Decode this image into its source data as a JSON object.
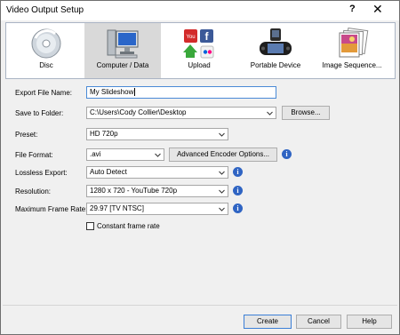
{
  "window": {
    "title": "Video Output Setup",
    "help_glyph": "?",
    "close_glyph": "✕"
  },
  "tabs": [
    {
      "label": "Disc",
      "icon": "disc-icon",
      "selected": false
    },
    {
      "label": "Computer / Data",
      "icon": "computer-icon",
      "selected": true
    },
    {
      "label": "Upload",
      "icon": "upload-icon",
      "selected": false
    },
    {
      "label": "Portable Device",
      "icon": "portable-device-icon",
      "selected": false
    },
    {
      "label": "Image Sequence...",
      "icon": "image-sequence-icon",
      "selected": false
    }
  ],
  "form": {
    "export_name": {
      "label": "Export File Name:",
      "value": "My Slideshow"
    },
    "save_folder": {
      "label": "Save to Folder:",
      "value": "C:\\Users\\Cody Collier\\Desktop",
      "browse": "Browse..."
    },
    "preset": {
      "label": "Preset:",
      "value": "HD 720p"
    },
    "file_format": {
      "label": "File Format:",
      "value": ".avi",
      "advanced": "Advanced Encoder Options..."
    },
    "lossless": {
      "label": "Lossless Export:",
      "value": "Auto Detect"
    },
    "resolution": {
      "label": "Resolution:",
      "value": "1280 x 720 - YouTube 720p"
    },
    "frame_rate": {
      "label": "Maximum Frame Rate:",
      "value": "29.97 [TV NTSC]"
    },
    "constant_frame_rate": {
      "label": "Constant frame rate",
      "checked": false
    }
  },
  "buttons": {
    "create": "Create",
    "cancel": "Cancel",
    "help": "Help"
  },
  "info_glyph": "i",
  "colors": {
    "accent": "#2f64c3",
    "selected_tab": "#d9d9d9",
    "focus_border": "#4a8ad6"
  }
}
